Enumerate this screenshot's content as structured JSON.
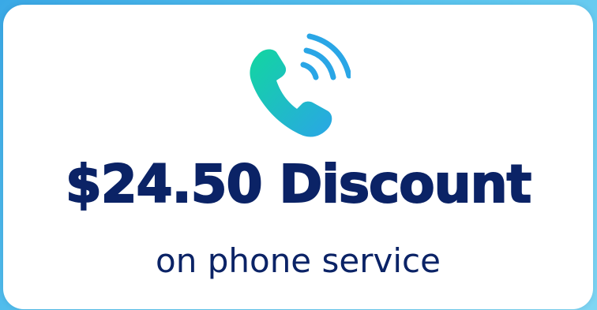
{
  "offer": {
    "icon": "phone-call-icon",
    "headline": "$24.50 Discount",
    "subline": "on phone service"
  },
  "colors": {
    "background_gradient": [
      "#3aa9e6",
      "#7fd6f3"
    ],
    "card": "#ffffff",
    "text": "#0b2366",
    "icon_gradient": [
      "#12d6a0",
      "#2aa6e6"
    ]
  }
}
